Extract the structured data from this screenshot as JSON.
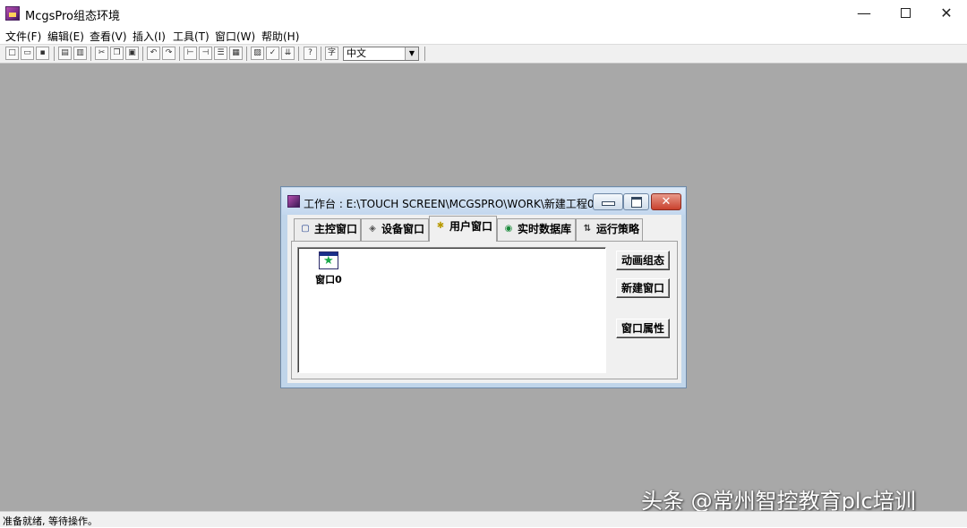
{
  "app": {
    "title": "McgsPro组态环境"
  },
  "window_controls": {
    "minimize": "—",
    "close": "✕"
  },
  "menu": [
    "文件(F)",
    "编辑(E)",
    "查看(V)",
    "插入(I)",
    "工具(T)",
    "窗口(W)",
    "帮助(H)"
  ],
  "toolbar": {
    "buttons": [
      {
        "icon": "new-file-icon",
        "glyph": "□"
      },
      {
        "icon": "open-folder-icon",
        "glyph": "▭"
      },
      {
        "icon": "save-icon",
        "glyph": "▪"
      },
      {
        "icon": "print-icon",
        "glyph": "▤"
      },
      {
        "icon": "print-preview-icon",
        "glyph": "▥"
      },
      {
        "icon": "cut-icon",
        "glyph": "✂"
      },
      {
        "icon": "copy-icon",
        "glyph": "❐"
      },
      {
        "icon": "paste-icon",
        "glyph": "▣"
      },
      {
        "icon": "undo-icon",
        "glyph": "↶"
      },
      {
        "icon": "redo-icon",
        "glyph": "↷"
      },
      {
        "icon": "align-left-icon",
        "glyph": "⊢"
      },
      {
        "icon": "tree-icon",
        "glyph": "⊣"
      },
      {
        "icon": "list-icon",
        "glyph": "☰"
      },
      {
        "icon": "grid-icon",
        "glyph": "▦"
      },
      {
        "icon": "properties-icon",
        "glyph": "▨"
      },
      {
        "icon": "check-icon",
        "glyph": "✓"
      },
      {
        "icon": "download-icon",
        "glyph": "⇊"
      },
      {
        "icon": "help-icon",
        "glyph": "?"
      },
      {
        "icon": "language-icon",
        "glyph": "字"
      }
    ],
    "language": {
      "selected": "中文",
      "arrow": "▼"
    }
  },
  "child_window": {
    "title": "工作台 : E:\\TOUCH SCREEN\\MCGSPRO\\WORK\\新建工程0....",
    "close_glyph": "✕",
    "tabs": [
      {
        "label": "主控窗口",
        "icon": "main-window-icon",
        "glyph": "▢",
        "active": false
      },
      {
        "label": "设备窗口",
        "icon": "device-icon",
        "glyph": "◈",
        "active": false
      },
      {
        "label": "用户窗口",
        "icon": "user-window-icon",
        "glyph": "✱",
        "active": true
      },
      {
        "label": "实时数据库",
        "icon": "database-icon",
        "glyph": "◉",
        "active": false
      },
      {
        "label": "运行策略",
        "icon": "strategy-icon",
        "glyph": "⇅",
        "active": false
      }
    ],
    "items": [
      {
        "label": "窗口0"
      }
    ],
    "buttons": {
      "animate": "动画组态",
      "new_window": "新建窗口",
      "properties": "窗口属性"
    }
  },
  "status": {
    "text": "准备就绪, 等待操作。"
  },
  "watermark": {
    "text": "头条 @常州智控教育plc培训"
  },
  "colors": {
    "workspace": "#a8a8a8",
    "titlebar_child": "#c3d7ee",
    "close_red": "#c9412d"
  }
}
